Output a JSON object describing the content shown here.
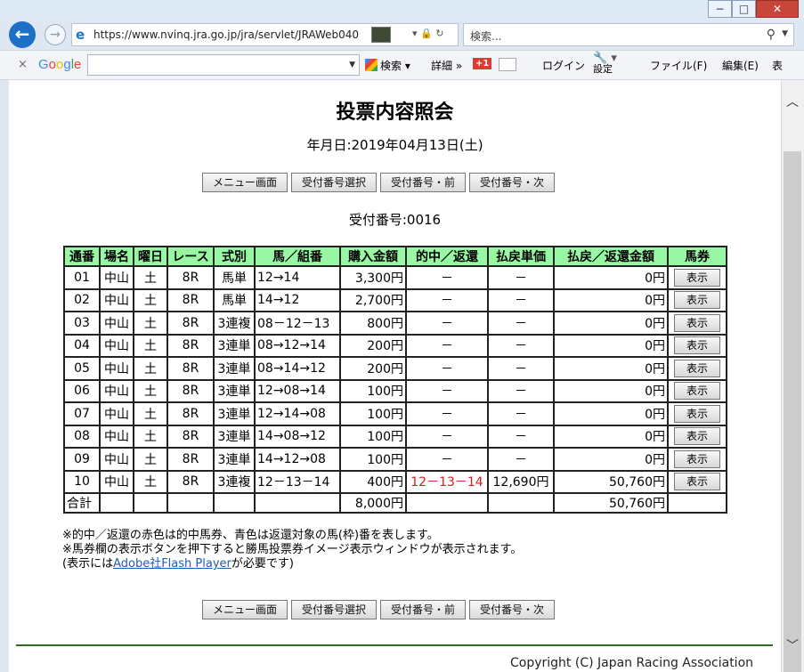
{
  "browser": {
    "address": "https://www.nvinq.jra.go.jp/jra/servlet/JRAWeb040",
    "search_placeholder": "検索...",
    "toolbar": {
      "search_label": "検索",
      "detail_label": "詳細",
      "gplus_label": "+1",
      "login_label": "ログイン",
      "settings_label": "設定",
      "menu_file": "ファイル(F)",
      "menu_edit": "編集(E)",
      "menu_more": "表"
    }
  },
  "page": {
    "title": "投票内容照会",
    "date": "年月日:2019年04月13日(土)",
    "buttons": {
      "menu": "メニュー画面",
      "select": "受付番号選択",
      "prev": "受付番号・前",
      "next": "受付番号・次"
    },
    "receipt": "受付番号:0016",
    "headers": [
      "通番",
      "場名",
      "曜日",
      "レース",
      "式別",
      "馬／組番",
      "購入金額",
      "的中／返還",
      "払戻単価",
      "払戻／返還金額",
      "馬券"
    ],
    "show_label": "表示",
    "rows": [
      {
        "no": "01",
        "venue": "中山",
        "day": "土",
        "race": "8R",
        "type": "馬単",
        "combo": "12→14",
        "amount": "3,300円",
        "hit": "－",
        "unit": "－",
        "payout": "0円"
      },
      {
        "no": "02",
        "venue": "中山",
        "day": "土",
        "race": "8R",
        "type": "馬単",
        "combo": "14→12",
        "amount": "2,700円",
        "hit": "－",
        "unit": "－",
        "payout": "0円"
      },
      {
        "no": "03",
        "venue": "中山",
        "day": "土",
        "race": "8R",
        "type": "3連複",
        "combo": "08－12－13",
        "amount": "800円",
        "hit": "－",
        "unit": "－",
        "payout": "0円"
      },
      {
        "no": "04",
        "venue": "中山",
        "day": "土",
        "race": "8R",
        "type": "3連単",
        "combo": "08→12→14",
        "amount": "200円",
        "hit": "－",
        "unit": "－",
        "payout": "0円"
      },
      {
        "no": "05",
        "venue": "中山",
        "day": "土",
        "race": "8R",
        "type": "3連単",
        "combo": "08→14→12",
        "amount": "200円",
        "hit": "－",
        "unit": "－",
        "payout": "0円"
      },
      {
        "no": "06",
        "venue": "中山",
        "day": "土",
        "race": "8R",
        "type": "3連単",
        "combo": "12→08→14",
        "amount": "100円",
        "hit": "－",
        "unit": "－",
        "payout": "0円"
      },
      {
        "no": "07",
        "venue": "中山",
        "day": "土",
        "race": "8R",
        "type": "3連単",
        "combo": "12→14→08",
        "amount": "100円",
        "hit": "－",
        "unit": "－",
        "payout": "0円"
      },
      {
        "no": "08",
        "venue": "中山",
        "day": "土",
        "race": "8R",
        "type": "3連単",
        "combo": "14→08→12",
        "amount": "100円",
        "hit": "－",
        "unit": "－",
        "payout": "0円"
      },
      {
        "no": "09",
        "venue": "中山",
        "day": "土",
        "race": "8R",
        "type": "3連単",
        "combo": "14→12→08",
        "amount": "100円",
        "hit": "－",
        "unit": "－",
        "payout": "0円"
      },
      {
        "no": "10",
        "venue": "中山",
        "day": "土",
        "race": "8R",
        "type": "3連複",
        "combo": "12－13－14",
        "amount": "400円",
        "hit": "12－13－14",
        "hit_red": true,
        "unit": "12,690円",
        "payout": "50,760円"
      }
    ],
    "total": {
      "label": "合計",
      "amount": "8,000円",
      "payout": "50,760円"
    },
    "notes": {
      "line1": "※的中／返還の赤色は的中馬券、青色は返還対象の馬(枠)番を表します。",
      "line2": "※馬券欄の表示ボタンを押下すると勝馬投票券イメージ表示ウィンドウが表示されます。",
      "line3_pre": "(表示には",
      "line3_link": "Adobe社Flash Player",
      "line3_post": "が必要です)"
    },
    "copyright": "Copyright (C) Japan Racing Association"
  },
  "colors": {
    "header_bg": "#98f7a2",
    "hit_red": "#e0181c",
    "footer_line": "#2f6e1e"
  }
}
